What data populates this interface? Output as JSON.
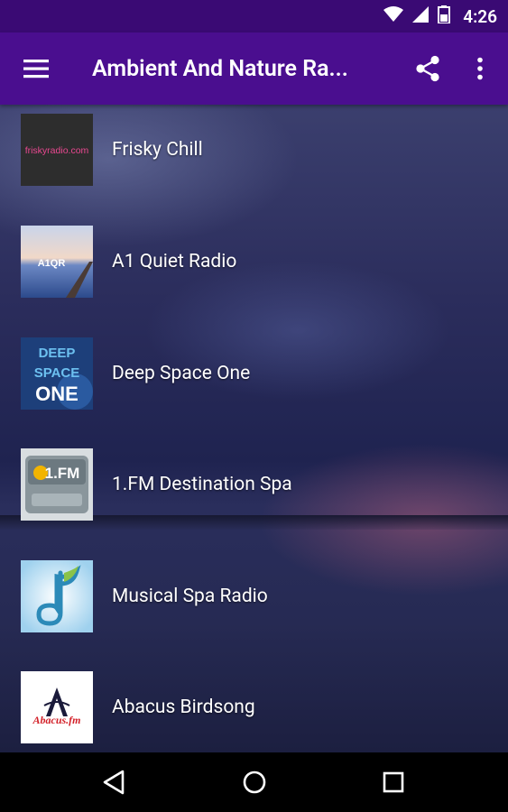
{
  "status_bar": {
    "time": "4:26",
    "icons": [
      "wifi-icon",
      "signal-icon",
      "battery-icon"
    ]
  },
  "app_bar": {
    "title": "Ambient And Nature Ra...",
    "icons": [
      "menu-icon",
      "share-icon",
      "more-vert-icon"
    ]
  },
  "stations": [
    {
      "name": "Frisky Chill",
      "logo_text": "friskyradio.com"
    },
    {
      "name": "A1 Quiet Radio",
      "logo_text": "A1QR"
    },
    {
      "name": "Deep Space One",
      "logo_text": "DEEP SPACE ONE"
    },
    {
      "name": "1.FM Destination Spa",
      "logo_text": "1.FM"
    },
    {
      "name": "Musical Spa Radio",
      "logo_text": ""
    },
    {
      "name": "Abacus Birdsong",
      "logo_text": "Abacus.fm"
    }
  ],
  "nav_bar": {
    "icons": [
      "back-icon",
      "home-icon",
      "recents-icon"
    ]
  },
  "colors": {
    "status_bar": "#3a0a74",
    "app_bar": "#4a0e8f"
  }
}
